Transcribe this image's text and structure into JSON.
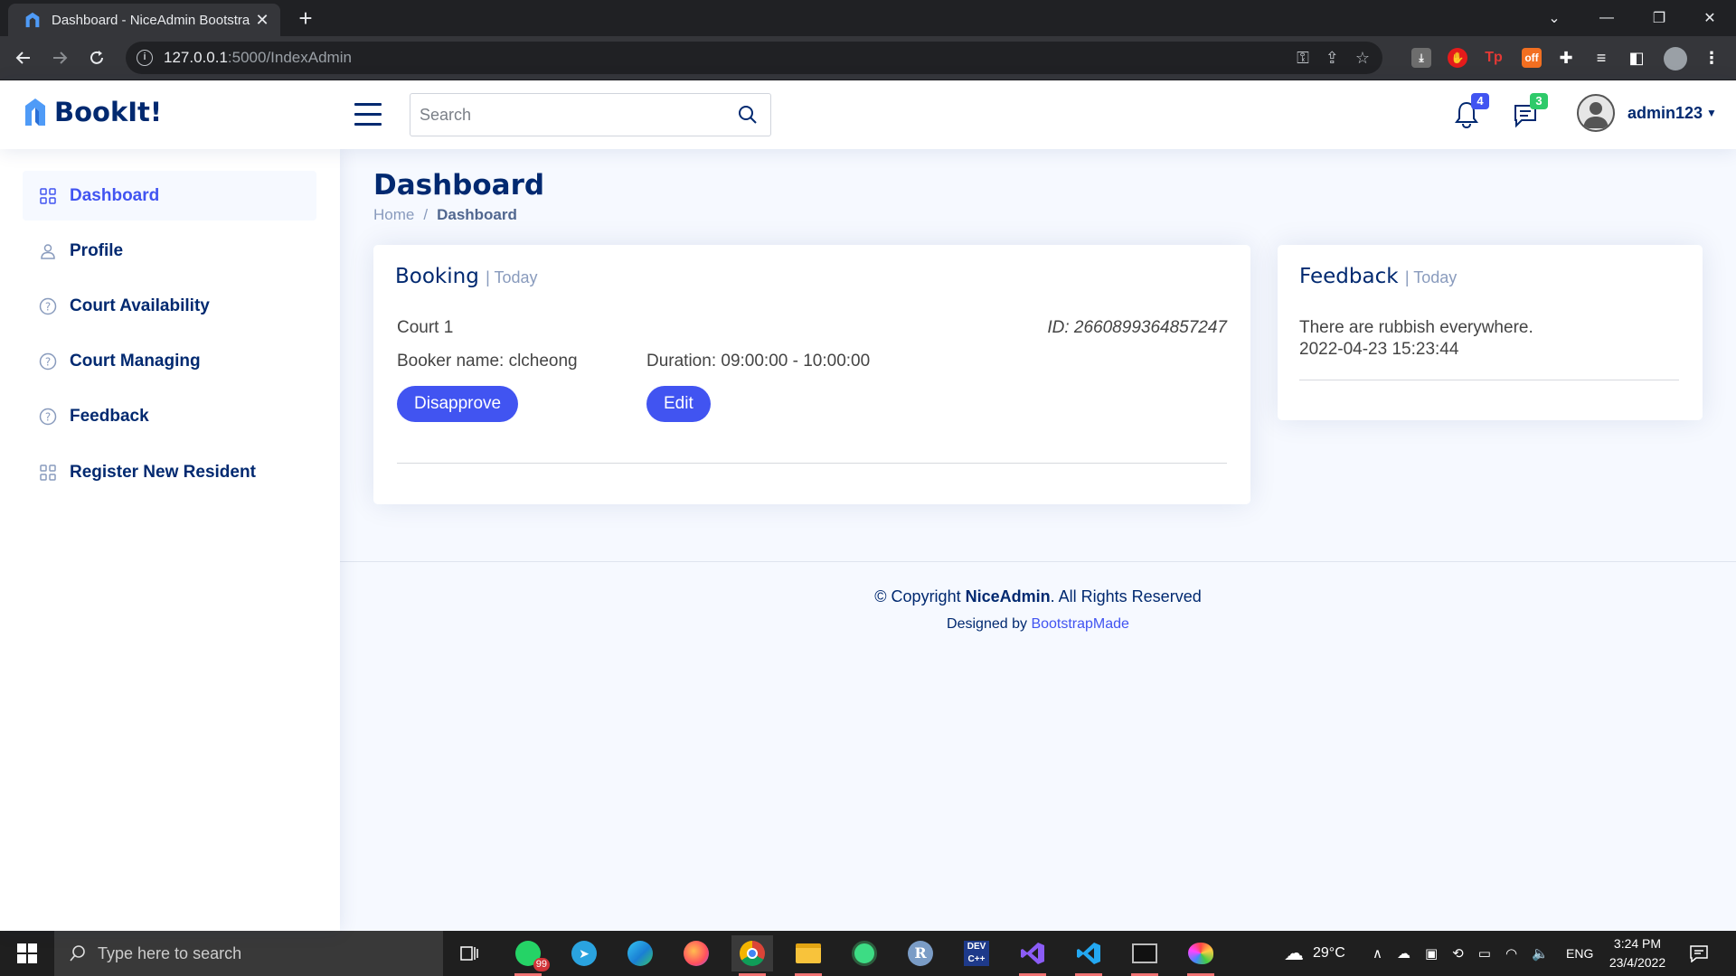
{
  "browser": {
    "tab_title": "Dashboard - NiceAdmin Bootstra",
    "url_host": "127.0.0.1",
    "url_rest": ":5000/IndexAdmin"
  },
  "header": {
    "brand": "BookIt!",
    "search_placeholder": "Search",
    "notifications_count": "4",
    "messages_count": "3",
    "username": "admin123"
  },
  "sidebar": {
    "items": [
      {
        "label": "Dashboard",
        "icon": "grid-icon"
      },
      {
        "label": "Profile",
        "icon": "person-icon"
      },
      {
        "label": "Court Availability",
        "icon": "question-circle-icon"
      },
      {
        "label": "Court Managing",
        "icon": "question-circle-icon"
      },
      {
        "label": "Feedback",
        "icon": "question-circle-icon"
      },
      {
        "label": "Register New Resident",
        "icon": "grid-icon"
      }
    ]
  },
  "page": {
    "title": "Dashboard",
    "breadcrumb_home": "Home",
    "breadcrumb_sep": "/",
    "breadcrumb_current": "Dashboard"
  },
  "booking": {
    "title": "Booking",
    "subtitle": "| Today",
    "court": "Court 1",
    "id": "ID: 2660899364857247",
    "booker": "Booker name: clcheong",
    "duration": "Duration: 09:00:00 - 10:00:00",
    "disapprove_label": "Disapprove",
    "edit_label": "Edit"
  },
  "feedback": {
    "title": "Feedback",
    "subtitle": "| Today",
    "message": "There are rubbish everywhere.",
    "timestamp": "2022-04-23 15:23:44"
  },
  "footer": {
    "copyright_prefix": "© Copyright",
    "brand": "NiceAdmin",
    "copyright_suffix": ". All Rights Reserved",
    "designed_by": "Designed by",
    "designer": "BootstrapMade"
  },
  "taskbar": {
    "search_placeholder": "Type here to search",
    "whatsapp_badge": "99",
    "temperature": "29°C",
    "language": "ENG",
    "time": "3:24 PM",
    "date": "23/4/2022"
  },
  "colors": {
    "primary": "#4154f1",
    "navy": "#012970",
    "muted": "#899bbd",
    "background": "#f6f9ff"
  }
}
